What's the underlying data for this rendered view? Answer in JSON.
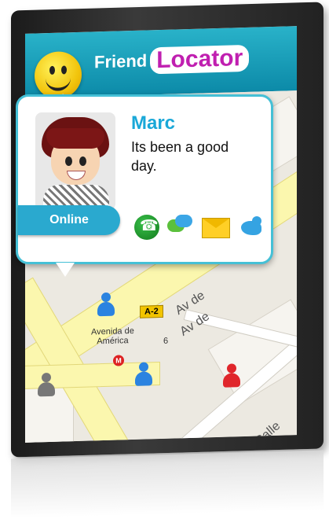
{
  "app": {
    "title_part1": "Friend",
    "title_part2": "Locator"
  },
  "map": {
    "labels": {
      "avenida": "Avenida de\nAmérica",
      "av_de_1": "Av de",
      "av_de_2": "Av de",
      "calle": "Calle de",
      "number_6": "6"
    },
    "metro": "M",
    "sign": "A-2"
  },
  "profile": {
    "name": "Marc",
    "status_message": "Its been a good day.",
    "online_label": "Online"
  },
  "actions": [
    "phone-icon",
    "chat-icon",
    "mail-icon",
    "twitter-bird-icon"
  ],
  "colors": {
    "header": "#1aa0bd",
    "accent": "#c01fb0",
    "name": "#1aa8d8",
    "online": "#2aa9cf"
  }
}
